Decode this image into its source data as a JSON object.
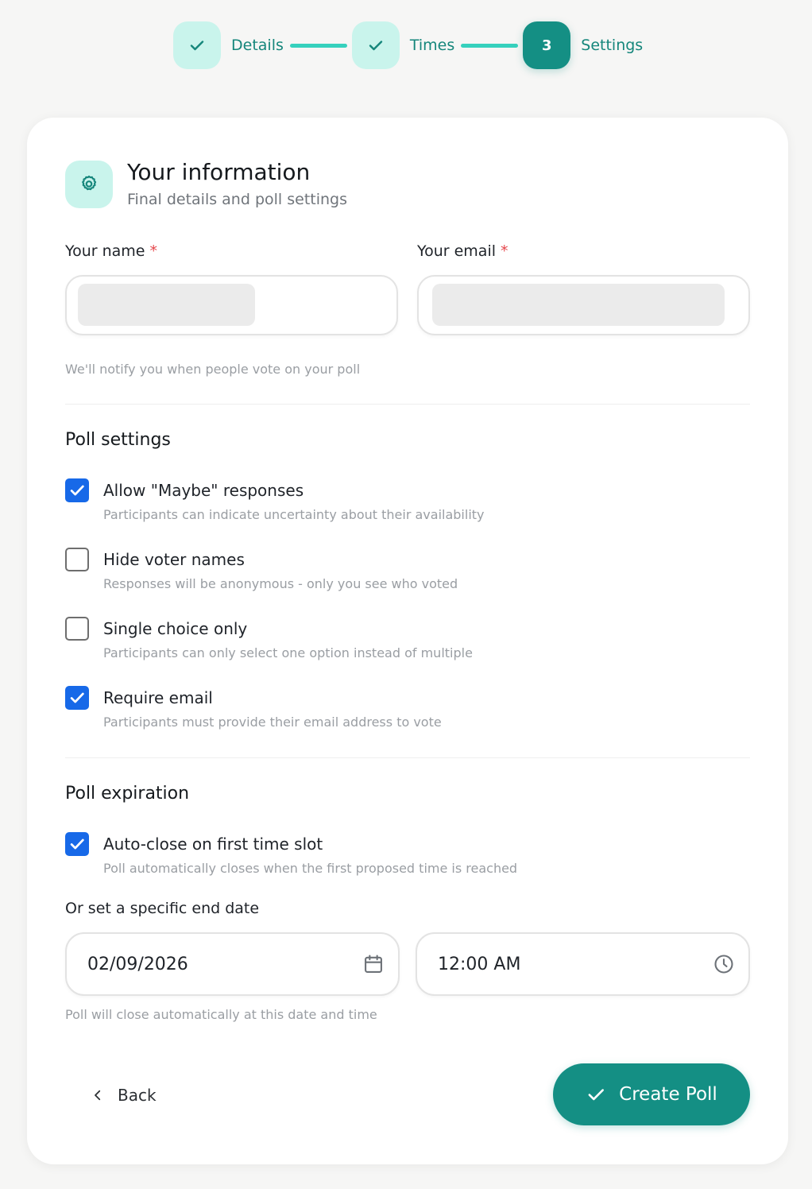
{
  "stepper": {
    "steps": [
      {
        "label": "Details",
        "state": "done"
      },
      {
        "label": "Times",
        "state": "done"
      },
      {
        "label": "Settings",
        "state": "active",
        "number": "3"
      }
    ]
  },
  "header": {
    "icon": "gear-icon",
    "title": "Your information",
    "subtitle": "Final details and poll settings"
  },
  "form": {
    "name_label": "Your name",
    "email_label": "Your email",
    "required_marker": "*",
    "name_value": "",
    "email_value": "",
    "notify_hint": "We'll notify you when people vote on your poll"
  },
  "poll_settings": {
    "title": "Poll settings",
    "options": [
      {
        "label": "Allow \"Maybe\" responses",
        "desc": "Participants can indicate uncertainty about their availability",
        "checked": true
      },
      {
        "label": "Hide voter names",
        "desc": "Responses will be anonymous - only you see who voted",
        "checked": false
      },
      {
        "label": "Single choice only",
        "desc": "Participants can only select one option instead of multiple",
        "checked": false
      },
      {
        "label": "Require email",
        "desc": "Participants must provide their email address to vote",
        "checked": true
      }
    ]
  },
  "expiration": {
    "title": "Poll expiration",
    "auto_close": {
      "label": "Auto-close on first time slot",
      "desc": "Poll automatically closes when the first proposed time is reached",
      "checked": true
    },
    "end_date_label": "Or set a specific end date",
    "date_value": "02/09/2026",
    "time_value": "12:00 AM",
    "close_hint": "Poll will close automatically at this date and time"
  },
  "actions": {
    "back_label": "Back",
    "create_label": "Create Poll"
  },
  "colors": {
    "accent": "#148f84",
    "accent_light": "#c9f4ec",
    "checkbox": "#1769e8",
    "required": "#e5484d"
  }
}
